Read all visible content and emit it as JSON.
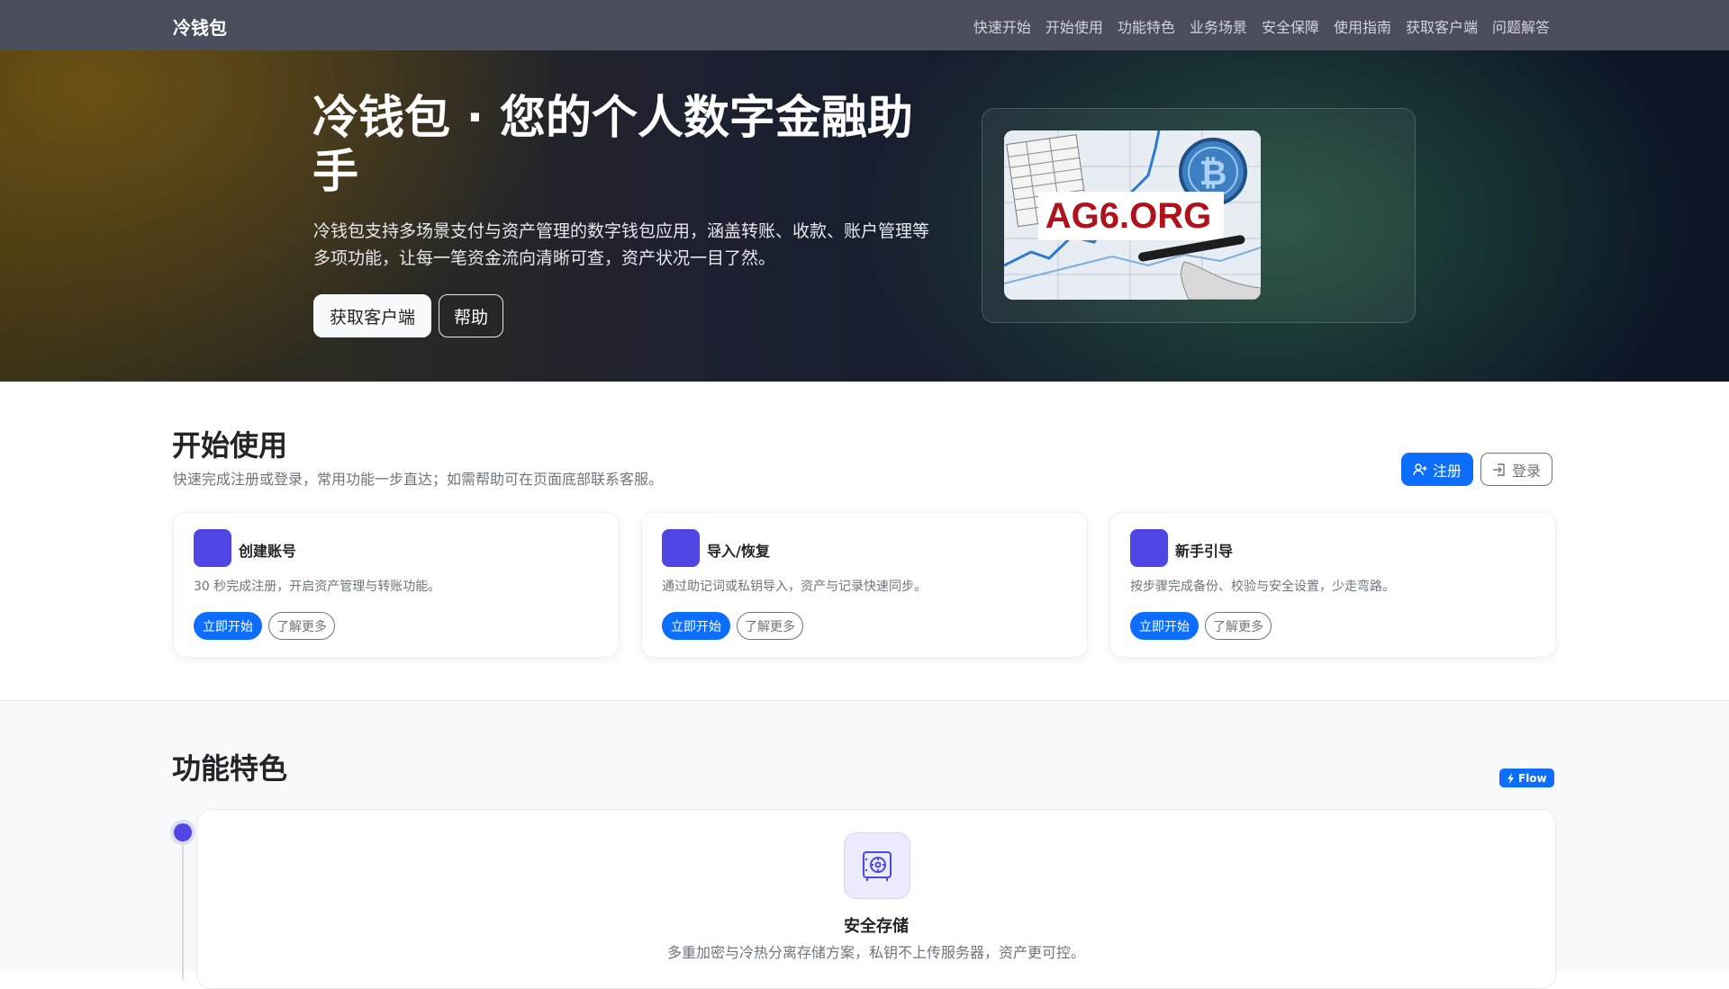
{
  "nav": {
    "brand": "冷钱包",
    "links": [
      "快速开始",
      "开始使用",
      "功能特色",
      "业务场景",
      "安全保障",
      "使用指南",
      "获取客户端",
      "问题解答"
    ]
  },
  "hero": {
    "title": "冷钱包 · 您的个人数字金融助手",
    "description": "冷钱包支持多场景支付与资产管理的数字钱包应用，涵盖转账、收款、账户管理等多项功能，让每一笔资金流向清晰可查，资产状况一目了然。",
    "primary_button": "获取客户端",
    "secondary_button": "帮助",
    "image_text": "AG6.ORG"
  },
  "getting_started": {
    "title": "开始使用",
    "description": "快速完成注册或登录，常用功能一步直达；如需帮助可在页面底部联系客服。",
    "register_button": "注册",
    "login_button": "登录",
    "cards": [
      {
        "title": "创建账号",
        "description": "30 秒完成注册，开启资产管理与转账功能。",
        "start": "立即开始",
        "more": "了解更多"
      },
      {
        "title": "导入/恢复",
        "description": "通过助记词或私钥导入，资产与记录快速同步。",
        "start": "立即开始",
        "more": "了解更多"
      },
      {
        "title": "新手引导",
        "description": "按步骤完成备份、校验与安全设置，少走弯路。",
        "start": "立即开始",
        "more": "了解更多"
      }
    ]
  },
  "features": {
    "title": "功能特色",
    "badge": "Flow",
    "items": [
      {
        "title": "安全存储",
        "description": "多重加密与冷热分离存储方案，私钥不上传服务器，资产更可控。",
        "icon": "safe-icon"
      }
    ]
  },
  "colors": {
    "nav_bg": "#4a4e5c",
    "primary": "#0d6efd",
    "accent": "#4f46e5"
  }
}
